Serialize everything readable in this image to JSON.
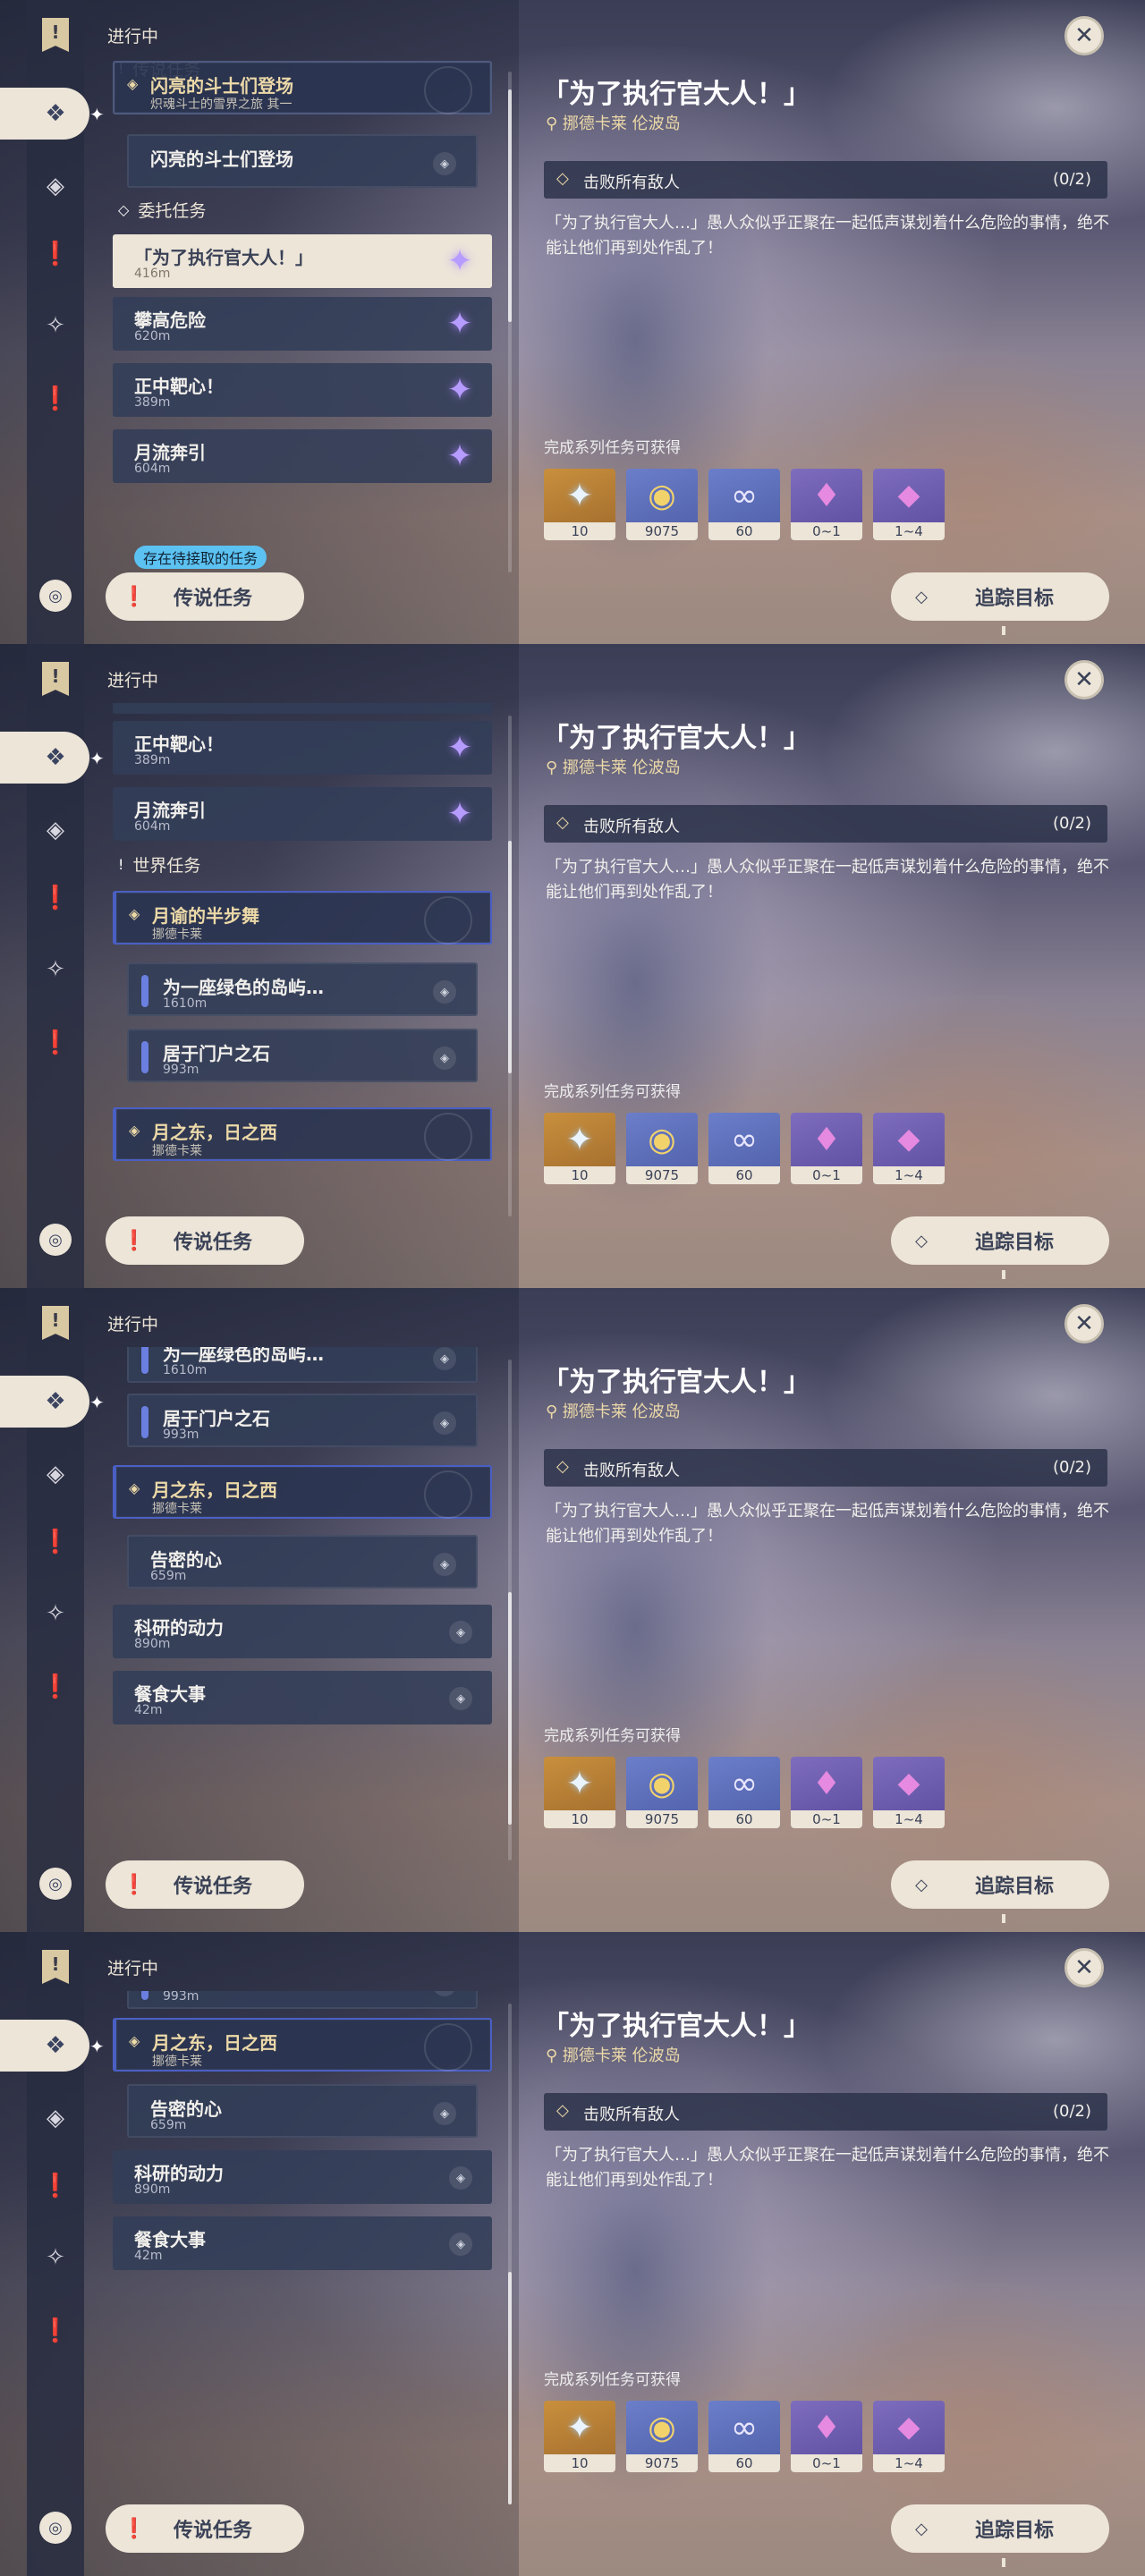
{
  "header": {
    "ongoing": "进行中"
  },
  "icons": {
    "bookmark": "!",
    "bottom": "◎",
    "close": "✕",
    "pin": "◈",
    "diamond": "◇"
  },
  "quest_sections": {
    "legend": "传说任务",
    "commission": "委托任务",
    "world": "世界任务"
  },
  "quests": {
    "legend_parent": {
      "title": "闪亮的斗士们登场",
      "subtitle": "炽魂斗士的雪界之旅 其一"
    },
    "legend_child": {
      "title": "闪亮的斗士们登场"
    },
    "commission": [
      {
        "title": "「为了执行官大人！」",
        "dist": "416m"
      },
      {
        "title": "攀高危险",
        "dist": "620m"
      },
      {
        "title": "正中靶心！",
        "dist": "389m"
      },
      {
        "title": "月流奔引",
        "dist": "604m"
      }
    ],
    "world_parent1": {
      "title": "月谕的半步舞",
      "subtitle": "挪德卡莱"
    },
    "world_children1": [
      {
        "title": "为一座绿色的岛屿…",
        "dist": "1610m"
      },
      {
        "title": "居于门户之石",
        "dist": "993m"
      }
    ],
    "world_parent2": {
      "title": "月之东，日之西",
      "subtitle": "挪德卡莱"
    },
    "world_children2": [
      {
        "title": "告密的心",
        "dist": "659m"
      }
    ],
    "other": [
      {
        "title": "科研的动力",
        "dist": "890m"
      },
      {
        "title": "餐食大事",
        "dist": "42m"
      }
    ]
  },
  "pending_badge": "存在待接取的任务",
  "buttons": {
    "legend": "传说任务",
    "track": "追踪目标"
  },
  "detail": {
    "title": "「为了执行官大人！」",
    "location": "挪德卡莱 伦波岛",
    "objective": "击败所有敌人",
    "progress": "(0/2)",
    "description": "「为了执行官大人…」愚人众似乎正聚在一起低声谋划着什么危险的事情，绝不能让他们再到处作乱了！",
    "rewards_label": "完成系列任务可获得",
    "rewards": [
      {
        "name": "primogem",
        "qty": "10"
      },
      {
        "name": "mora",
        "qty": "9075"
      },
      {
        "name": "adventure-exp",
        "qty": "60"
      },
      {
        "name": "crystal",
        "qty": "0~1"
      },
      {
        "name": "crystal-cluster",
        "qty": "1~4"
      }
    ]
  }
}
